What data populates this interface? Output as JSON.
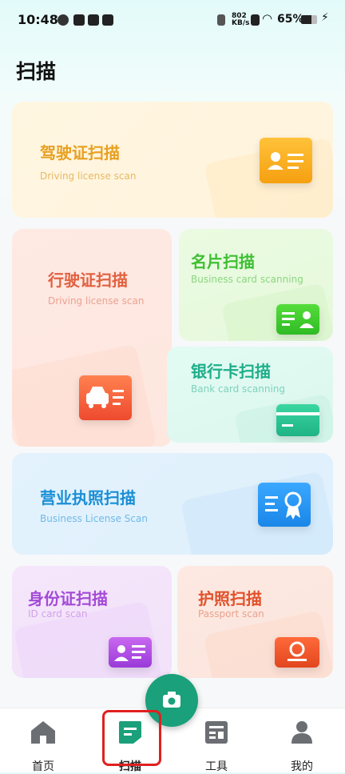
{
  "status_bar": {
    "time": "10:48",
    "net_speed": "802\nKB/s",
    "battery": "65%"
  },
  "page_title": "扫描",
  "cards": {
    "driving_license": {
      "title": "驾驶证扫描",
      "subtitle": "Driving license scan",
      "color": "#e8a020"
    },
    "vehicle_license": {
      "title": "行驶证扫描",
      "subtitle": "Driving license scan",
      "color": "#e2603f"
    },
    "business_card": {
      "title": "名片扫描",
      "subtitle": "Business card scanning",
      "color": "#3ebf33"
    },
    "bank_card": {
      "title": "银行卡扫描",
      "subtitle": "Bank card scanning",
      "color": "#1fae8a"
    },
    "business_license": {
      "title": "营业执照扫描",
      "subtitle": "Business License Scan",
      "color": "#1a8fd6"
    },
    "id_card": {
      "title": "身份证扫描",
      "subtitle": "ID card scan",
      "color": "#a34ad6"
    },
    "passport": {
      "title": "护照扫描",
      "subtitle": "Passport scan",
      "color": "#e2502a"
    }
  },
  "nav": {
    "home": "首页",
    "scan": "扫描",
    "tools": "工具",
    "mine": "我的"
  },
  "fab_icon": "camera-icon"
}
